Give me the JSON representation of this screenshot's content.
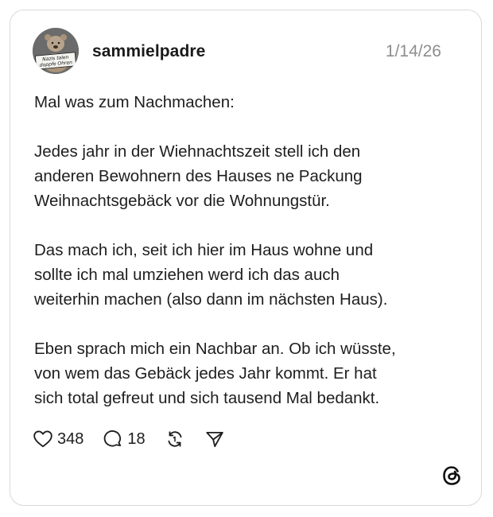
{
  "post": {
    "username": "sammielpadre",
    "timestamp": "1/14/26",
    "avatar_sign_text": [
      "Nazis talen",
      "doppfe Ohren"
    ],
    "paragraphs": [
      [
        "Mal was zum Nachmachen:"
      ],
      [
        "Jedes jahr in der Wiehnachtszeit stell ich den",
        "anderen Bewohnern des Hauses ne Packung",
        "Weihnachtsgebäck vor die Wohnungstür."
      ],
      [
        "Das mach ich, seit ich hier im Haus wohne und",
        "sollte ich mal umziehen werd ich das auch",
        "weiterhin machen (also dann im nächsten Haus)."
      ],
      [
        "Eben sprach mich ein Nachbar an. Ob ich wüsste,",
        "von wem das Gebäck jedes Jahr kommt. Er hat",
        "sich total gefreut und sich tausend Mal bedankt."
      ]
    ]
  },
  "actions": {
    "likes": "348",
    "replies": "18",
    "like_icon": "heart-icon",
    "reply_icon": "speech-bubble-icon",
    "repost_icon": "repost-icon",
    "share_icon": "send-icon"
  },
  "branding": {
    "logo_icon": "threads-logo-icon"
  },
  "colors": {
    "text": "#1e1e1e",
    "muted": "#8e8e8e",
    "border": "#d9d9d9"
  }
}
